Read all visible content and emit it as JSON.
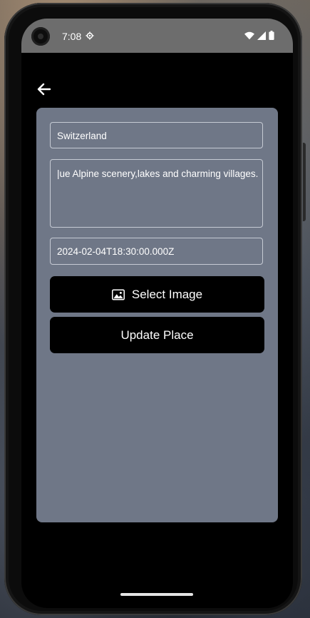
{
  "status_bar": {
    "time": "7:08",
    "settings_icon": "gear-icon",
    "wifi_icon": "wifi-icon",
    "signal_icon": "cell-signal-icon",
    "battery_icon": "battery-icon"
  },
  "nav": {
    "back_icon": "arrow-left-icon"
  },
  "form": {
    "country_value": "Switzerland",
    "description_value": "|ue Alpine scenery,lakes and charming villages.",
    "date_value": "2024-02-04T18:30:00.000Z",
    "select_image_label": "Select Image",
    "select_image_icon": "image-icon",
    "update_label": "Update Place"
  },
  "colors": {
    "card_background": "#6f7787",
    "button_background": "#000000",
    "text": "#ffffff",
    "field_border": "#c6cbd4"
  }
}
